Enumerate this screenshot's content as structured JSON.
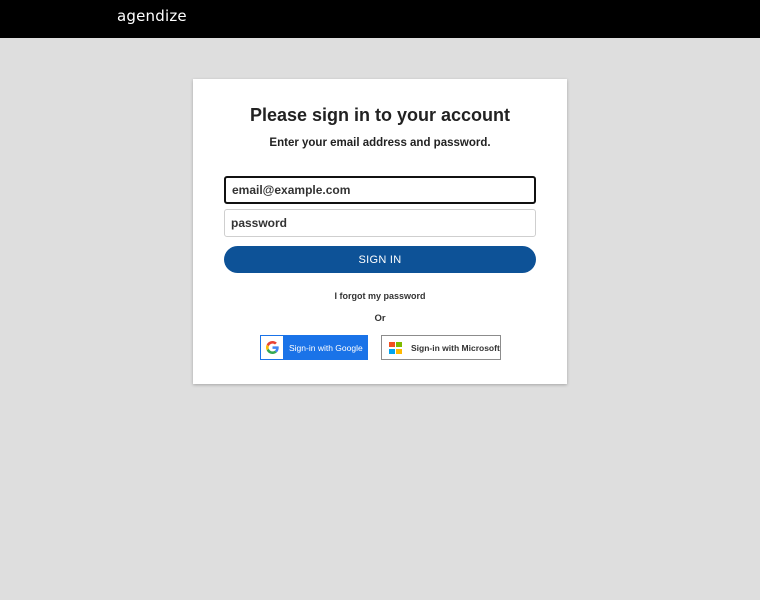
{
  "header": {
    "brand": "agendize",
    "logo_icon": "agendize-logo"
  },
  "login": {
    "title": "Please sign in to your account",
    "subtitle": "Enter your email address and password.",
    "email_placeholder": "email@example.com",
    "email_value": "",
    "password_placeholder": "password",
    "password_value": "",
    "signin_label": "SIGN IN",
    "forgot_label": "I forgot my password",
    "or_label": "Or",
    "google_label": "Sign-in with Google",
    "google_icon": "google-g-icon",
    "microsoft_label": "Sign-in with Microsoft",
    "microsoft_icon": "microsoft-logo-icon"
  },
  "colors": {
    "topbar": "#000000",
    "background": "#dedede",
    "primary": "#0d5297",
    "google_blue": "#1a73e8"
  }
}
